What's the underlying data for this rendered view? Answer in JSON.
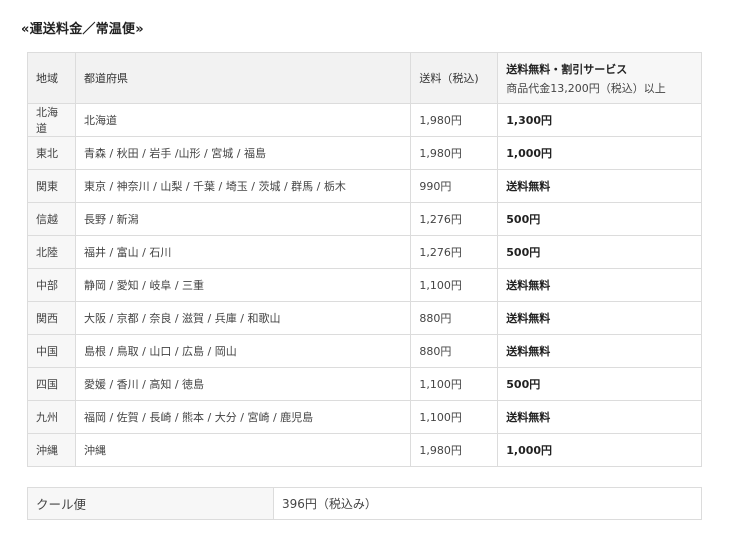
{
  "section_title": "«運送料金／常温便»",
  "table": {
    "headers": {
      "region": "地域",
      "prefectures": "都道府県",
      "fee": "送料（税込)",
      "free_title": "送料無料・割引サービス",
      "free_subtitle": "商品代金13,200円（税込）以上"
    },
    "rows": [
      {
        "region": "北海道",
        "prefectures": "北海道",
        "fee": "1,980円",
        "discount": "1,300円"
      },
      {
        "region": "東北",
        "prefectures": "青森 / 秋田 / 岩手 /山形 / 宮城 / 福島",
        "fee": "1,980円",
        "discount": "1,000円"
      },
      {
        "region": "関東",
        "prefectures": "東京 / 神奈川 / 山梨 / 千葉 / 埼玉 / 茨城 / 群馬 / 栃木",
        "fee": "990円",
        "discount": "送料無料"
      },
      {
        "region": "信越",
        "prefectures": "長野 / 新潟",
        "fee": "1,276円",
        "discount": "500円"
      },
      {
        "region": "北陸",
        "prefectures": "福井 / 富山 / 石川",
        "fee": "1,276円",
        "discount": "500円"
      },
      {
        "region": "中部",
        "prefectures": "静岡 / 愛知 / 岐阜 / 三重",
        "fee": "1,100円",
        "discount": "送料無料"
      },
      {
        "region": "関西",
        "prefectures": "大阪 / 京都 / 奈良 / 滋賀 / 兵庫 / 和歌山",
        "fee": "880円",
        "discount": "送料無料"
      },
      {
        "region": "中国",
        "prefectures": "島根 / 鳥取 / 山口 / 広島 / 岡山",
        "fee": "880円",
        "discount": "送料無料"
      },
      {
        "region": "四国",
        "prefectures": "愛媛 / 香川 / 高知 / 徳島",
        "fee": "1,100円",
        "discount": "500円"
      },
      {
        "region": "九州",
        "prefectures": "福岡 / 佐賀 / 長崎 / 熊本 / 大分 / 宮崎 / 鹿児島",
        "fee": "1,100円",
        "discount": "送料無料"
      },
      {
        "region": "沖縄",
        "prefectures": "沖縄",
        "fee": "1,980円",
        "discount": "1,000円"
      }
    ]
  },
  "cool": {
    "label": "クール便",
    "price": "396円（税込み）"
  }
}
